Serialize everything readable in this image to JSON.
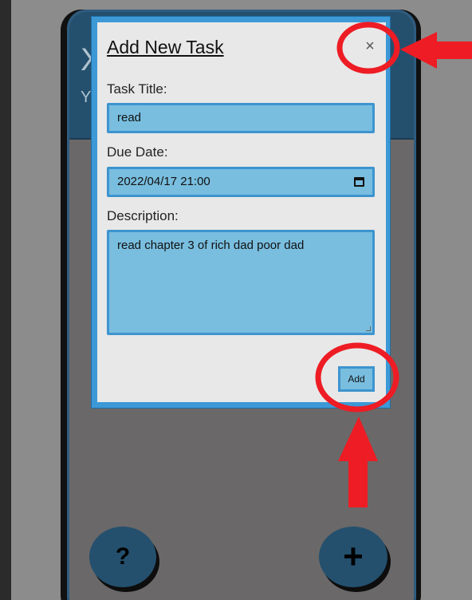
{
  "background_app": {
    "header_title_partial": "X",
    "header_subtitle_partial": "Y",
    "help_button_label": "?",
    "add_button_label": "+"
  },
  "modal": {
    "title": "Add New Task",
    "close_label": "×",
    "fields": {
      "task_title": {
        "label": "Task Title:",
        "value": "read"
      },
      "due_date": {
        "label": "Due Date:",
        "value": "2022/04/17 21:00"
      },
      "description": {
        "label": "Description:",
        "value": "read chapter 3 of rich dad poor dad"
      }
    },
    "submit_label": "Add"
  },
  "annotations": {
    "color": "#ee1c24",
    "highlighted": [
      "close-button",
      "add-task-button"
    ]
  }
}
